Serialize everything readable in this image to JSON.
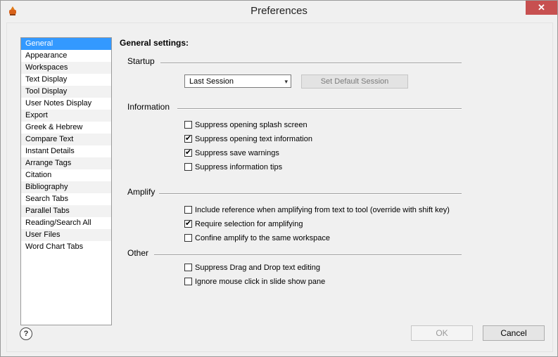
{
  "window": {
    "title": "Preferences",
    "close_label": "✕"
  },
  "sidebar": {
    "items": [
      {
        "label": "General",
        "selected": true
      },
      {
        "label": "Appearance"
      },
      {
        "label": "Workspaces"
      },
      {
        "label": "Text Display"
      },
      {
        "label": "Tool Display"
      },
      {
        "label": "User Notes Display"
      },
      {
        "label": "Export"
      },
      {
        "label": "Greek & Hebrew"
      },
      {
        "label": "Compare Text"
      },
      {
        "label": "Instant Details"
      },
      {
        "label": "Arrange Tags"
      },
      {
        "label": "Citation"
      },
      {
        "label": "Bibliography"
      },
      {
        "label": "Search Tabs"
      },
      {
        "label": "Parallel Tabs"
      },
      {
        "label": "Reading/Search All"
      },
      {
        "label": "User Files"
      },
      {
        "label": "Word Chart Tabs"
      }
    ]
  },
  "main": {
    "heading": "General settings:",
    "startup": {
      "label": "Startup",
      "session_value": "Last Session",
      "set_default_label": "Set Default Session"
    },
    "information": {
      "label": "Information",
      "options": [
        {
          "label": "Suppress opening splash screen",
          "checked": false
        },
        {
          "label": "Suppress opening text information",
          "checked": true
        },
        {
          "label": "Suppress save warnings",
          "checked": true
        },
        {
          "label": "Suppress information tips",
          "checked": false
        }
      ]
    },
    "amplify": {
      "label": "Amplify",
      "options": [
        {
          "label": "Include reference when amplifying from text to tool (override with shift key)",
          "checked": false
        },
        {
          "label": "Require selection for amplifying",
          "checked": true
        },
        {
          "label": "Confine amplify to the same workspace",
          "checked": false
        }
      ]
    },
    "other": {
      "label": "Other",
      "options": [
        {
          "label": "Suppress Drag and Drop text editing",
          "checked": false
        },
        {
          "label": "Ignore mouse click in slide show pane",
          "checked": false
        }
      ]
    }
  },
  "footer": {
    "help_label": "?",
    "ok_label": "OK",
    "cancel_label": "Cancel"
  },
  "icons": {
    "check": "✔",
    "chevron": "▾"
  },
  "colors": {
    "selection": "#3399ff",
    "close": "#c75050"
  }
}
